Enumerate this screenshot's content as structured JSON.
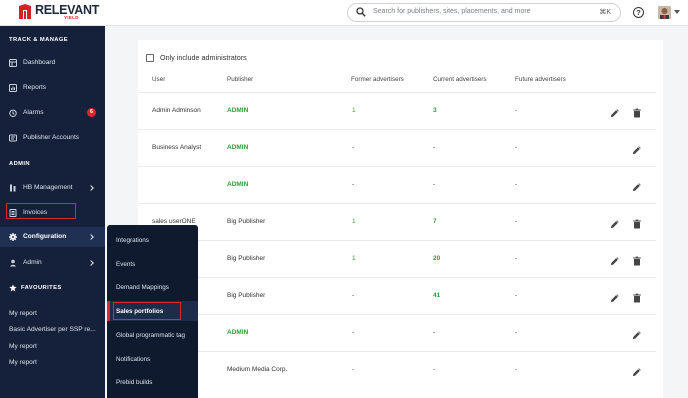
{
  "app": {
    "logo_text": "RELEVANT",
    "logo_sub": "YIELD",
    "search_placeholder": "Search for publishers, sites, placements, and more",
    "search_shortcut": "⌘K",
    "help_glyph": "?"
  },
  "colors": {
    "sidebar_bg": "#15213a",
    "accent_red": "#e0262e",
    "green_text": "#2e9e3f"
  },
  "sidebar": {
    "track_header": "TRACK & MANAGE",
    "track_items": [
      {
        "label": "Dashboard",
        "icon": "dashboard-icon"
      },
      {
        "label": "Reports",
        "icon": "reports-icon"
      },
      {
        "label": "Alarms",
        "icon": "alarm-icon",
        "badge": "6"
      },
      {
        "label": "Publisher Accounts",
        "icon": "publisher-accounts-icon"
      }
    ],
    "admin_header": "ADMIN",
    "admin_items": [
      {
        "label": "HB Management",
        "icon": "hb-management-icon"
      },
      {
        "label": "Invoices",
        "icon": "invoices-icon"
      },
      {
        "label": "Configuration",
        "icon": "gear-icon"
      },
      {
        "label": "Admin",
        "icon": "admin-icon"
      }
    ],
    "favourites_header": "FAVOURITES",
    "favourites": [
      "My report",
      "Basic Advertiser per SSP re...",
      "My report",
      "My report"
    ]
  },
  "flyout": {
    "items": [
      "Integrations",
      "Events",
      "Demand Mappings",
      "Sales portfolios",
      "Global programmatic tag",
      "Notifications",
      "Prebid builds"
    ],
    "active_index": 3
  },
  "main": {
    "checkbox_label": "Only include administrators",
    "columns": [
      "User",
      "Publisher",
      "Former advertisers",
      "Current advertisers",
      "Future advertisers"
    ],
    "rows": [
      {
        "user": "Admin Adminson",
        "publisher": "ADMIN",
        "former": "1",
        "current": "3",
        "future": "-",
        "deletable": true
      },
      {
        "user": "Business Analyst",
        "publisher": "ADMIN",
        "former": "-",
        "current": "-",
        "future": "-",
        "deletable": false
      },
      {
        "user": "",
        "publisher": "ADMIN",
        "former": "-",
        "current": "-",
        "future": "-",
        "deletable": false
      },
      {
        "user": "sales userONE",
        "publisher": "Big Publisher",
        "former": "1",
        "current": "7",
        "future": "-",
        "deletable": true
      },
      {
        "user": "",
        "publisher": "Big Publisher",
        "former": "1",
        "current": "20",
        "future": "-",
        "deletable": true
      },
      {
        "user": "",
        "publisher": "Big Publisher",
        "former": "-",
        "current": "41",
        "future": "-",
        "deletable": true
      },
      {
        "user": "",
        "publisher": "ADMIN",
        "former": "-",
        "current": "-",
        "future": "-",
        "deletable": false
      },
      {
        "user": "",
        "publisher": "Medium Media Corp.",
        "former": "-",
        "current": "-",
        "future": "-",
        "deletable": false
      }
    ]
  }
}
